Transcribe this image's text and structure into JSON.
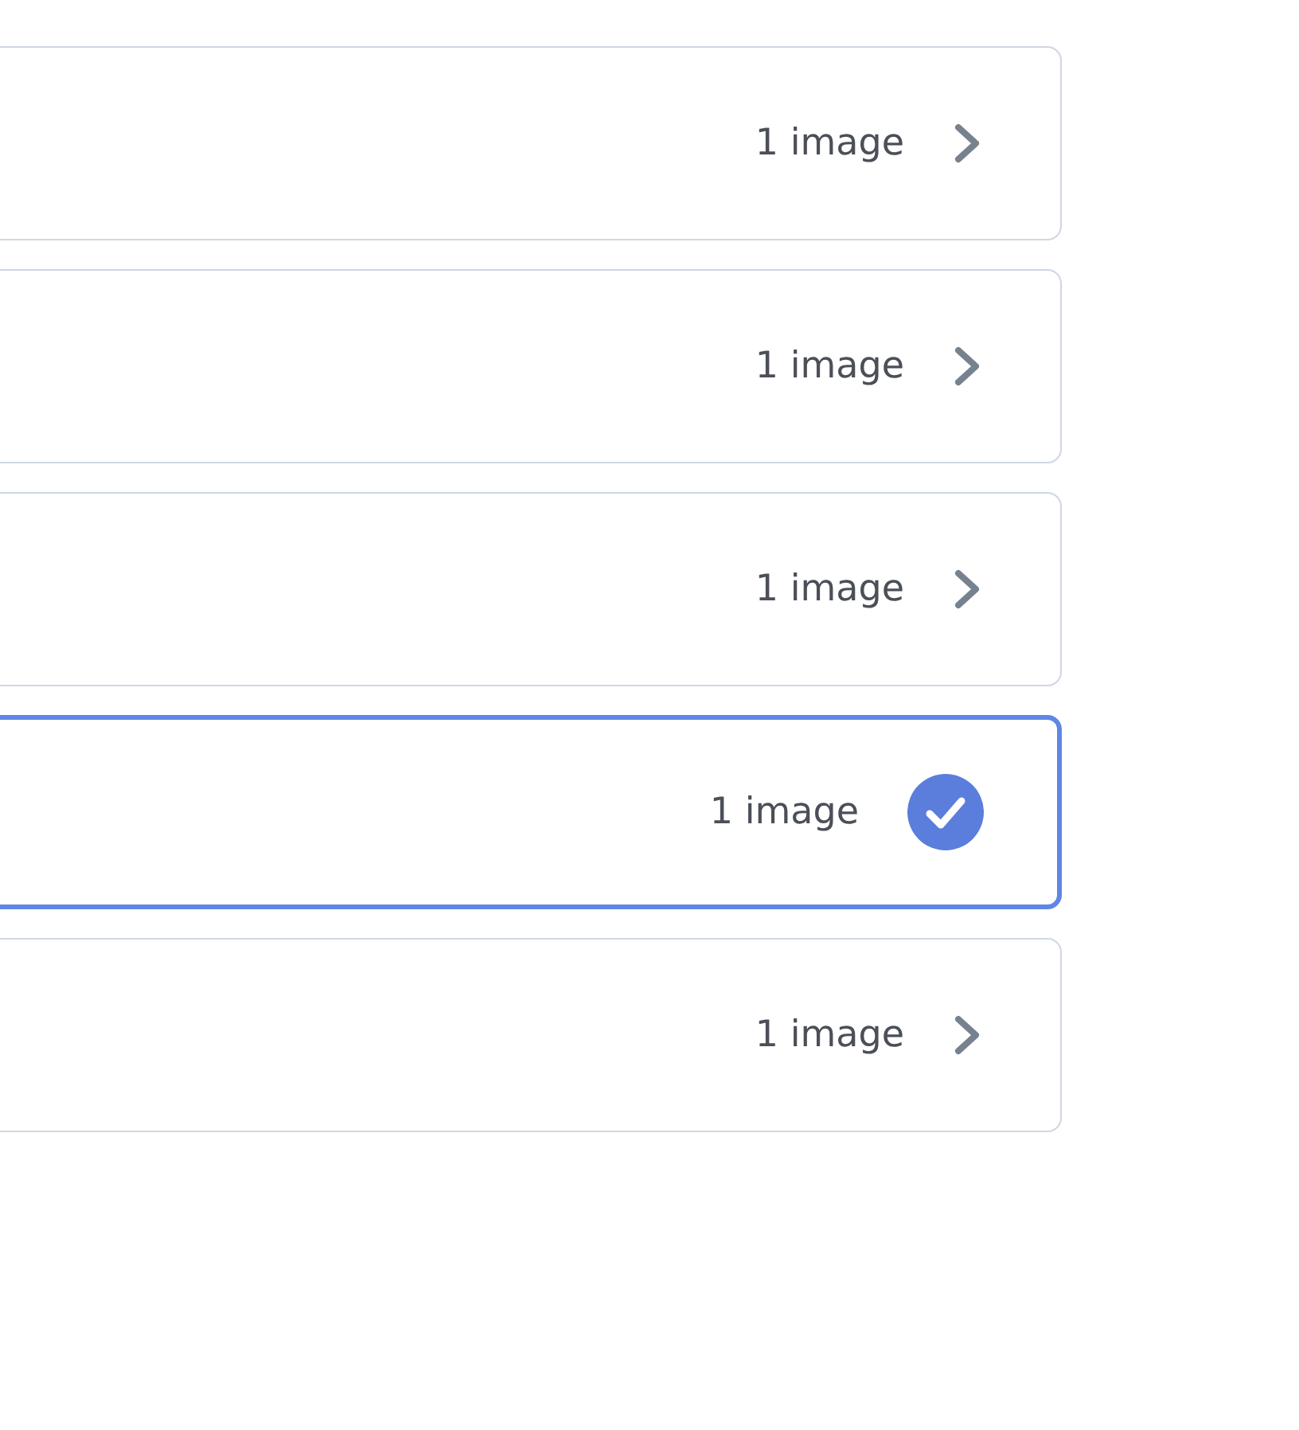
{
  "options": [
    {
      "count": "1 image",
      "selected": false
    },
    {
      "count": "1 image",
      "selected": false
    },
    {
      "count": "1 image",
      "selected": false
    },
    {
      "count": "1 image",
      "selected": true
    },
    {
      "count": "1 image",
      "selected": false
    }
  ]
}
